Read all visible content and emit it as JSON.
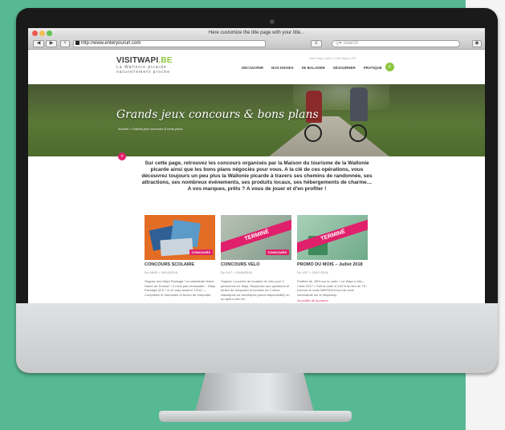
{
  "browser": {
    "title": "Here customize the title page with your title...",
    "back": "◀",
    "forward": "▶",
    "plus": "+",
    "url": "http://www.enteryoururl.com",
    "reload": "c",
    "search_placeholder": "Q▾ Search"
  },
  "site": {
    "logo_main": "VISITWAPI",
    "logo_accent": ".BE",
    "tagline_1": "La Wallonie picarde",
    "tagline_2": "naturellement proche",
    "topinfo": "Visit Wapi  |  Actu  |  Visit Wapi  |  FR",
    "nav": [
      "DÉCOUVRIR",
      "NOS ENVIES",
      "SE BALADER",
      "SÉJOURNER",
      "PRATIQUE"
    ],
    "search_icon": "search-icon"
  },
  "hero": {
    "title": "Grands jeux concours & bons plans",
    "breadcrumb": "Accueil > Grands jeux concours & bons plans",
    "scroll": "»"
  },
  "intro": "Sur cette page, retrouvez les concours organisés par la Maison du tourisme de la Wallonie picarde ainsi que les bons plans négociés pour vous.  A la clé de ces opérations, vous découvrez toujours un peu plus la Wallonie picarde à travers ses chemins de randonnée, ses attractions, ses nombreux événements, ses produits locaux, ses hébergements de charme… A vos marques, prêts ? A vous de jouer et d'en profiter !",
  "cards": [
    {
      "title": "CONCOURS SCOLAIRE",
      "date": "Du 18/09 > 19/10/2018",
      "desc": "Gagnez des Wapi Package \"La cathédrale Notre-Dame de Tournai\" ! Il n'est pas nécessaire... Wapi Package (3-6 + 8-12 ans) avant le 12/10 — Complétez le formulaire et tentez de remporter",
      "ribbon": "",
      "tag": "CONCOURS"
    },
    {
      "title": "CONCOURS VELO",
      "date": "Du 1/07 > 15/08/2018",
      "desc": "Gagnez 1 journée de location de vélo pour 2 personnes en Wapi. Répondez aux questions et tentez de remporter la location de 2 vélos classiques ou électriques (selon disponibilité) ou un apéro-vélo en",
      "ribbon": "TERMINÉ",
      "tag": "CONCOURS"
    },
    {
      "title": "PROMO DU MOIS – Juillet 2018",
      "date": "Du 1/07 > 31/07/2018",
      "desc": "Profitez de -50% sur la carte « Le Wapi à vélo – Carte 2017 » Soit la carte à 3,50 € au lieu de 7€ ! Donnez le code WAPI2018 lors de votre commande sur le Wapishop",
      "ribbon": "TERMINÉ",
      "tag": "",
      "link": "Je profite de la promo"
    }
  ]
}
